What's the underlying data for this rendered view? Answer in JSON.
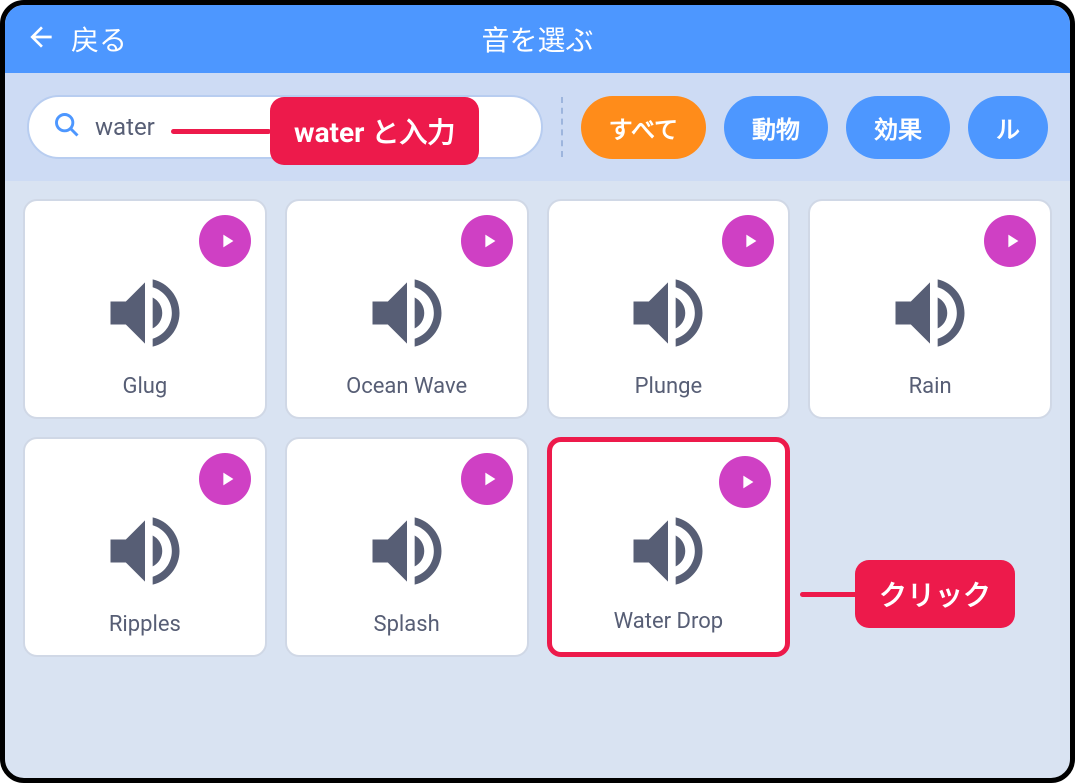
{
  "header": {
    "back_label": "戻る",
    "title": "音を選ぶ"
  },
  "search": {
    "value": "water",
    "placeholder": ""
  },
  "filters": {
    "tabs": [
      {
        "label": "すべて",
        "active": true
      },
      {
        "label": "動物",
        "active": false
      },
      {
        "label": "効果",
        "active": false
      },
      {
        "label": "ル",
        "active": false
      }
    ]
  },
  "sounds": [
    {
      "name": "Glug",
      "highlighted": false
    },
    {
      "name": "Ocean Wave",
      "highlighted": false
    },
    {
      "name": "Plunge",
      "highlighted": false
    },
    {
      "name": "Rain",
      "highlighted": false
    },
    {
      "name": "Ripples",
      "highlighted": false
    },
    {
      "name": "Splash",
      "highlighted": false
    },
    {
      "name": "Water Drop",
      "highlighted": true
    }
  ],
  "annotations": {
    "search": "water と入力",
    "click": "クリック"
  },
  "icons": {
    "back": "back-arrow-icon",
    "search": "search-icon",
    "play": "play-icon",
    "sound": "speaker-icon"
  },
  "colors": {
    "primary": "#4d97ff",
    "accent": "#ff8c1a",
    "annotation": "#ed1a4b",
    "play": "#cf40c4",
    "icon": "#575e75"
  }
}
